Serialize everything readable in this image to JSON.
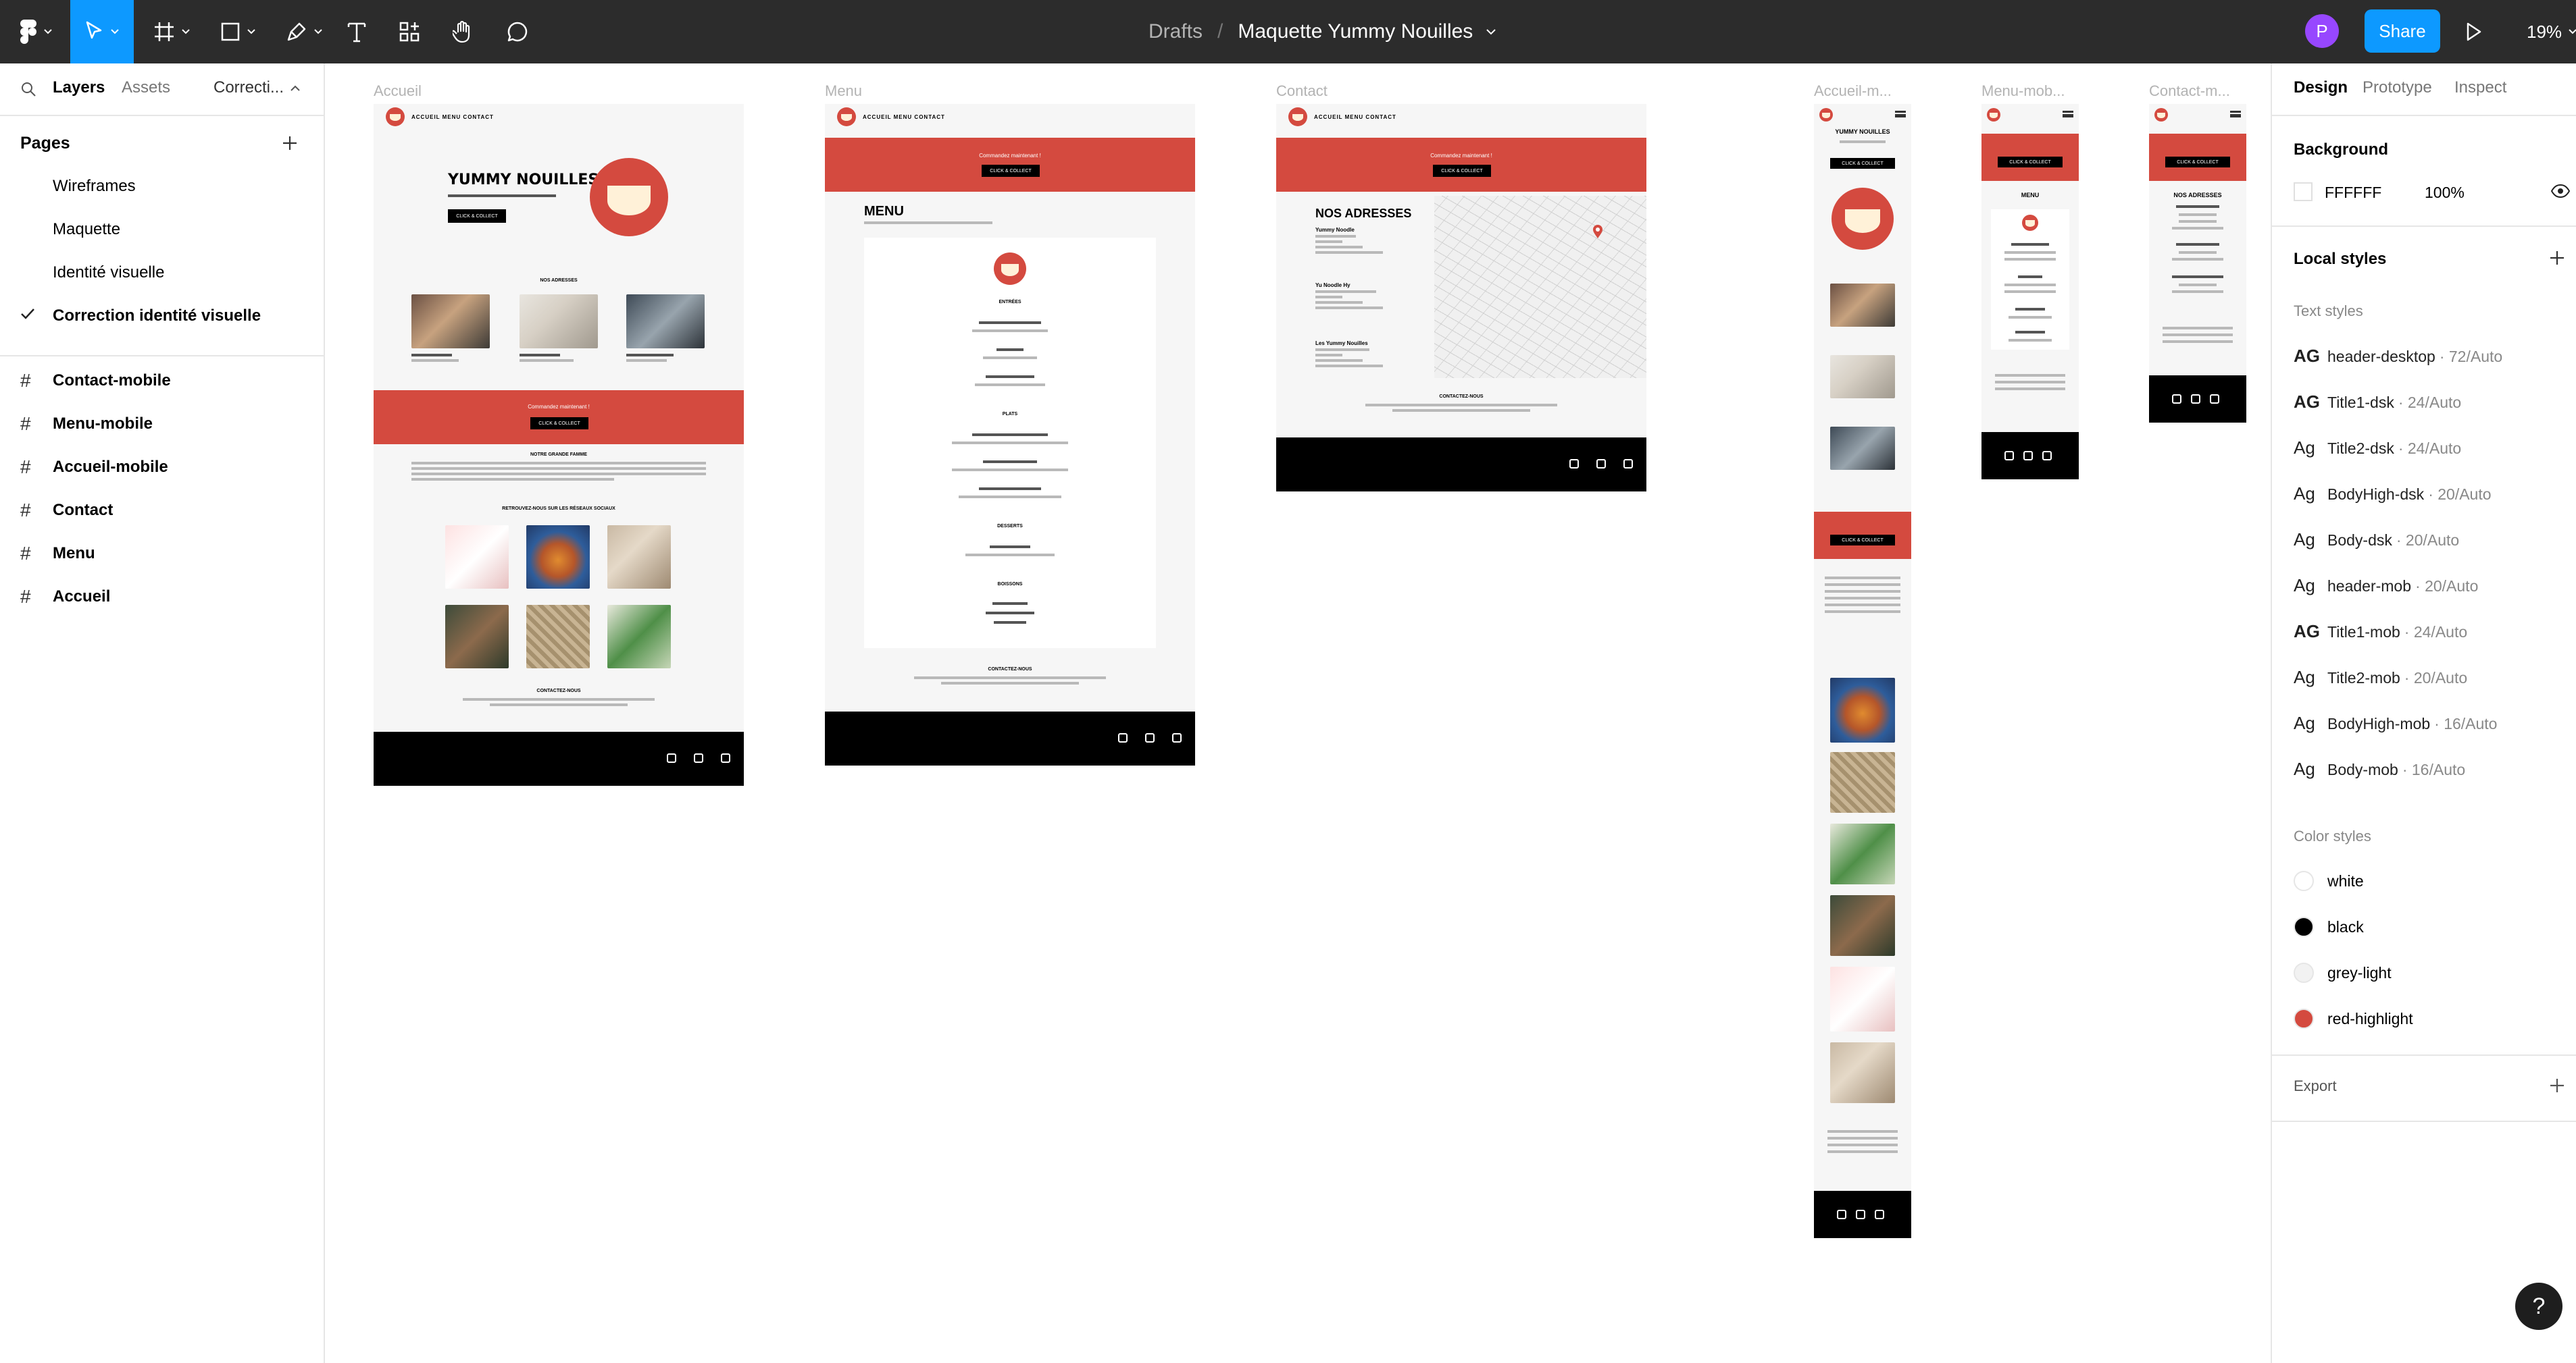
{
  "toolbar": {
    "file_path_root": "Drafts",
    "separator": "/",
    "file_name": "Maquette Yummy Nouilles",
    "avatar_initial": "P",
    "share_label": "Share",
    "zoom_label": "19%",
    "active_tool": "move",
    "accent_color": "#0d99ff"
  },
  "left_panel": {
    "tabs": [
      "Layers",
      "Assets",
      "Correcti..."
    ],
    "pages_title": "Pages",
    "pages": [
      "Wireframes",
      "Maquette",
      "Identité visuelle",
      "Correction identité visuelle"
    ],
    "current_page": "Correction identité visuelle",
    "layers": [
      "Contact-mobile",
      "Menu-mobile",
      "Accueil-mobile",
      "Contact",
      "Menu",
      "Accueil"
    ]
  },
  "canvas": {
    "frames": {
      "accueil": {
        "label": "Accueil",
        "nav": "ACCUEIL   MENU   CONTACT",
        "hero_title": "YUMMY NOUILLES",
        "hero_cta": "CLICK & COLLECT",
        "addresses_title": "NOS ADRESSES",
        "band_text": "Commandez maintenant !",
        "band_cta": "CLICK & COLLECT",
        "history_title": "NOTRE GRANDE FAMME",
        "social_title": "RETROUVEZ-NOUS SUR LES RÉSEAUX SOCIAUX",
        "contact_title": "CONTACTEZ-NOUS"
      },
      "menu": {
        "label": "Menu",
        "nav": "ACCUEIL   MENU   CONTACT",
        "band_text": "Commandez maintenant !",
        "band_cta": "CLICK & COLLECT",
        "title": "MENU",
        "sections": [
          "ENTRÉES",
          "PLATS",
          "DESSERTS",
          "BOISSONS"
        ],
        "contact_title": "CONTACTEZ-NOUS"
      },
      "contact": {
        "label": "Contact",
        "nav": "ACCUEIL   MENU   CONTACT",
        "band_text": "Commandez maintenant !",
        "band_cta": "CLICK & COLLECT",
        "title": "NOS ADRESSES",
        "restaurants": [
          "Yummy Noodle",
          "Yu Noodle Hy",
          "Les Yummy Nouilles"
        ],
        "contact_title": "CONTACTEZ-NOUS"
      },
      "accueil_mobile": {
        "label": "Accueil-m...",
        "hero_title": "YUMMY NOUILLES",
        "hero_cta": "CLICK & COLLECT"
      },
      "menu_mobile": {
        "label": "Menu-mob...",
        "title": "MENU",
        "band_cta": "CLICK & COLLECT"
      },
      "contact_mobile": {
        "label": "Contact-m...",
        "title": "NOS ADRESSES",
        "band_cta": "CLICK & COLLECT"
      }
    }
  },
  "right_panel": {
    "tabs": [
      "Design",
      "Prototype",
      "Inspect"
    ],
    "active_tab": "Design",
    "background_title": "Background",
    "background_hex": "FFFFFF",
    "background_opacity": "100%",
    "local_styles_title": "Local styles",
    "text_styles_title": "Text styles",
    "text_styles": [
      {
        "glyph": "AG",
        "name": "header-desktop",
        "meta": "· 72/Auto"
      },
      {
        "glyph": "AG",
        "name": "Title1-dsk",
        "meta": "· 24/Auto"
      },
      {
        "glyph": "Ag",
        "name": "Title2-dsk",
        "meta": "· 24/Auto"
      },
      {
        "glyph": "Ag",
        "name": "BodyHigh-dsk",
        "meta": "· 20/Auto"
      },
      {
        "glyph": "Ag",
        "name": "Body-dsk",
        "meta": "· 20/Auto"
      },
      {
        "glyph": "Ag",
        "name": "header-mob",
        "meta": "· 20/Auto"
      },
      {
        "glyph": "AG",
        "name": "Title1-mob",
        "meta": "· 24/Auto"
      },
      {
        "glyph": "Ag",
        "name": "Title2-mob",
        "meta": "· 20/Auto"
      },
      {
        "glyph": "Ag",
        "name": "BodyHigh-mob",
        "meta": "· 16/Auto"
      },
      {
        "glyph": "Ag",
        "name": "Body-mob",
        "meta": "· 16/Auto"
      }
    ],
    "color_styles_title": "Color styles",
    "color_styles": [
      {
        "name": "white",
        "color": "#ffffff"
      },
      {
        "name": "black",
        "color": "#000000"
      },
      {
        "name": "grey-light",
        "color": "#f2f2f2"
      },
      {
        "name": "red-highlight",
        "color": "#d44a3f"
      }
    ],
    "export_title": "Export"
  },
  "help_label": "?"
}
